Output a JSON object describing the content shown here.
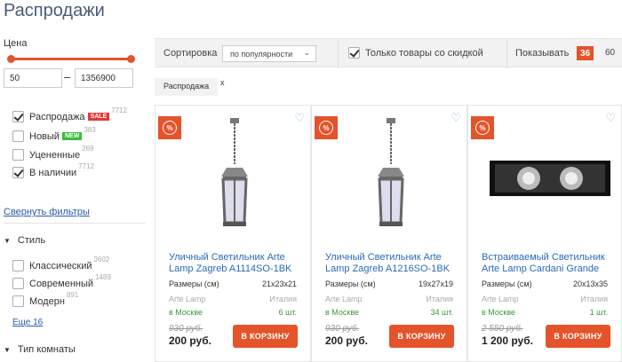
{
  "page": {
    "title": "Распродажи"
  },
  "sidebar": {
    "price": {
      "label": "Цена",
      "min": "50",
      "dash": "–",
      "max": "1356900"
    },
    "flags": [
      {
        "label": "Распродажа",
        "badge": "SALE",
        "badge_color": "#e53935",
        "count": "7712",
        "checked": true
      },
      {
        "label": "Новый",
        "badge": "NEW",
        "badge_color": "#3dbb3d",
        "count": "383",
        "checked": false
      },
      {
        "label": "Уцененные",
        "badge": "",
        "count": "269",
        "checked": false
      },
      {
        "label": "В наличии",
        "badge": "",
        "count": "7712",
        "checked": true
      }
    ],
    "collapse_link": "Свернуть фильтры",
    "style_group": {
      "title": "Стиль",
      "items": [
        {
          "label": "Классический",
          "count": "3602"
        },
        {
          "label": "Современный",
          "count": "1489"
        },
        {
          "label": "Модерн",
          "count": "891"
        }
      ],
      "more": "Еще 16"
    },
    "room_group": {
      "title": "Тип комнаты"
    }
  },
  "toolbar": {
    "sort_label": "Сортировка",
    "sort_value": "по популярности",
    "discount_label": "Только товары со скидкой",
    "show_label": "Показывать",
    "show_active": "36",
    "show_other": "60"
  },
  "active_filter": {
    "label": "Распродажа",
    "remove": "x"
  },
  "products": [
    {
      "name": "Уличный Светильник Arte Lamp Zagreb A1114SO-1BK",
      "size_label": "Размеры (см)",
      "size": "21x23x21",
      "brand": "Arte Lamp",
      "country": "Италия",
      "location": "в Москве",
      "stock": "6 шт.",
      "old_price": "930 руб.",
      "price": "200 руб.",
      "buy": "В КОРЗИНУ",
      "discount": "%"
    },
    {
      "name": "Уличный Светильник Arte Lamp Zagreb A1216SO-1BK",
      "size_label": "Размеры (см)",
      "size": "19x27x19",
      "brand": "Arte Lamp",
      "country": "Италия",
      "location": "в Москве",
      "stock": "34 шт.",
      "old_price": "930 руб.",
      "price": "200 руб.",
      "buy": "В КОРЗИНУ",
      "discount": "%"
    },
    {
      "name": "Встраиваемый Светильник Arte Lamp Cardani Grande",
      "size_label": "Размеры (см)",
      "size": "20x13x35",
      "brand": "Arte Lamp",
      "country": "Италия",
      "location": "в Москве",
      "stock": "1 шт.",
      "old_price": "2 550 руб.",
      "price": "1 200 руб.",
      "buy": "В КОРЗИНУ",
      "discount": "%"
    }
  ],
  "colors": {
    "accent": "#e5532a",
    "link": "#2a6ab8",
    "badge_active": "#e5532a"
  }
}
